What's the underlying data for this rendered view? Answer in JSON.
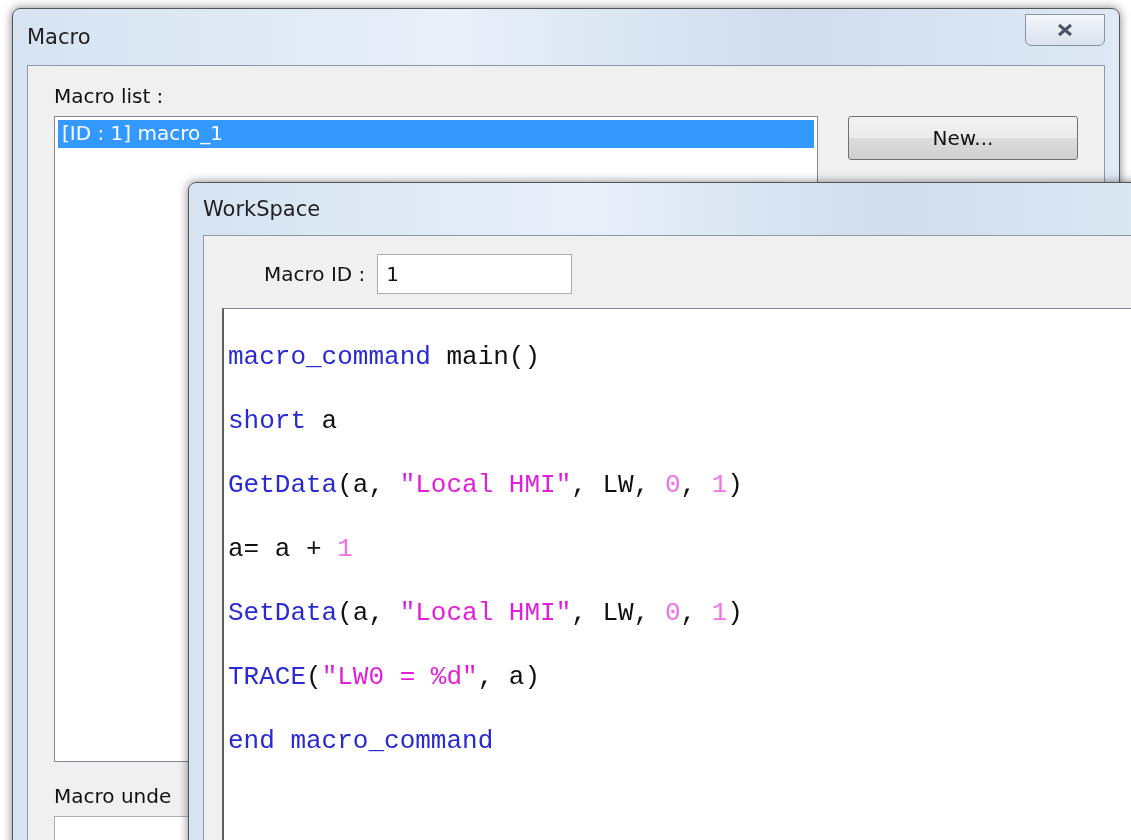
{
  "macro_window": {
    "title": "Macro",
    "list_label": "Macro list :",
    "macros": [
      {
        "label": "[ID : 1] macro_1",
        "selected": true
      }
    ],
    "buttons": [
      "New..."
    ],
    "under_label": "Macro unde"
  },
  "workspace_window": {
    "title": "WorkSpace",
    "id_label": "Macro ID :",
    "id_value": "1",
    "code_lines": [
      [
        {
          "text": "macro_command",
          "kind": "keyword"
        },
        {
          "text": " main()",
          "kind": "plain"
        }
      ],
      [
        {
          "text": "short",
          "kind": "keyword"
        },
        {
          "text": " a",
          "kind": "plain"
        }
      ],
      [
        {
          "text": "GetData",
          "kind": "keyword"
        },
        {
          "text": "(a, ",
          "kind": "plain"
        },
        {
          "text": "\"Local HMI\"",
          "kind": "string"
        },
        {
          "text": ", LW, ",
          "kind": "plain"
        },
        {
          "text": "0",
          "kind": "number"
        },
        {
          "text": ", ",
          "kind": "plain"
        },
        {
          "text": "1",
          "kind": "number"
        },
        {
          "text": ")",
          "kind": "plain"
        }
      ],
      [
        {
          "text": "a= a + ",
          "kind": "plain"
        },
        {
          "text": "1",
          "kind": "number"
        }
      ],
      [
        {
          "text": "SetData",
          "kind": "keyword"
        },
        {
          "text": "(a, ",
          "kind": "plain"
        },
        {
          "text": "\"Local HMI\"",
          "kind": "string"
        },
        {
          "text": ", LW, ",
          "kind": "plain"
        },
        {
          "text": "0",
          "kind": "number"
        },
        {
          "text": ", ",
          "kind": "plain"
        },
        {
          "text": "1",
          "kind": "number"
        },
        {
          "text": ")",
          "kind": "plain"
        }
      ],
      [
        {
          "text": "TRACE",
          "kind": "keyword"
        },
        {
          "text": "(",
          "kind": "plain"
        },
        {
          "text": "\"LW0 = %d\"",
          "kind": "string"
        },
        {
          "text": ", a)",
          "kind": "plain"
        }
      ],
      [
        {
          "text": "end macro_command",
          "kind": "keyword"
        }
      ]
    ]
  }
}
